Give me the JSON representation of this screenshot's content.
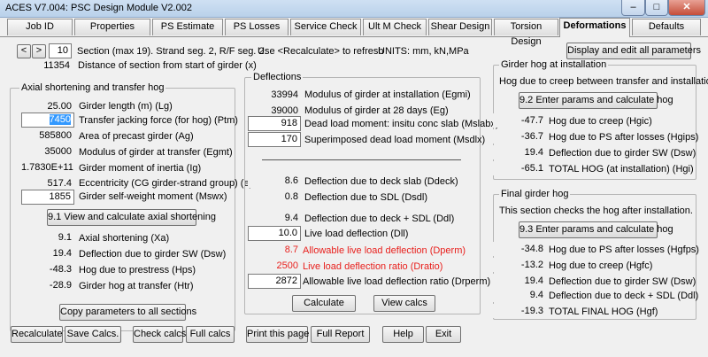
{
  "window": {
    "title": "ACES V7.004:  PSC Design Module V2.002",
    "minimize": "–",
    "maximize": "□",
    "close": "✕"
  },
  "tabs": [
    "Job ID",
    "Properties",
    "PS Estimate",
    "PS Losses",
    "Service Check",
    "Ult M Check",
    "Shear Design",
    "Torsion Design",
    "Deformations",
    "Defaults"
  ],
  "active_tab": "Deformations",
  "header": {
    "prev": "<",
    "next": ">",
    "section_no": "10",
    "section_info": "Section (max 19). Strand seg. 2, R/F seg. 2.",
    "refresh_hint": "Use <Recalculate> to refresh",
    "units": "UNITS: mm, kN,MPa",
    "display_all_button": "Display and edit all parameters",
    "distance_value": "11354",
    "distance_label": "Distance of section from start of girder (x)"
  },
  "axial": {
    "title": "Axial shortening and transfer hog",
    "rows": [
      {
        "value": "25.00",
        "label": "Girder length (m) (Lg)"
      },
      {
        "value": "7450",
        "label": "Transfer jacking force (for hog) (Ptm)"
      },
      {
        "value": "585800",
        "label": "Area of precast girder (Ag)"
      },
      {
        "value": "35000",
        "label": "Modulus of girder at transfer (Egmt)"
      },
      {
        "value": "1.7830E+11",
        "label": "Girder moment of inertia (Ig)"
      },
      {
        "value": "517.4",
        "label": "Eccentricity (CG girder-strand group) (e)"
      },
      {
        "value": "1855",
        "label": "Girder self-weight moment (Mswx)"
      }
    ],
    "calc_button": "9.1 View and calculate axial shortening",
    "results": [
      {
        "value": "9.1",
        "label": "Axial shortening (Xa)"
      },
      {
        "value": "19.4",
        "label": "Deflection due to girder SW (Dsw)"
      },
      {
        "value": "-48.3",
        "label": "Hog due to prestress (Hps)"
      },
      {
        "value": "-28.9",
        "label": "Girder hog at transfer (Htr)"
      }
    ],
    "copy_button": "Copy parameters to all sections"
  },
  "deflections": {
    "title": "Deflections",
    "rows": [
      {
        "value": "33994",
        "label": "Modulus of girder at installation (Egmi)"
      },
      {
        "value": "39000",
        "label": "Modulus of girder at 28 days (Eg)"
      },
      {
        "value": "918",
        "label": "Dead load moment: insitu conc slab (Mslabx)"
      },
      {
        "value": "170",
        "label": "Superimposed dead load moment (Msdlx)"
      }
    ],
    "results": [
      {
        "value": "8.6",
        "label": "Deflection due to deck slab (Ddeck)"
      },
      {
        "value": "0.8",
        "label": "Deflection due to SDL (Dsdl)"
      },
      {
        "value": "9.4",
        "label": "Deflection due to deck + SDL (Ddl)"
      },
      {
        "value": "10.0",
        "label": "Live load deflection (Dll)"
      },
      {
        "value": "8.7",
        "label": "Allowable live load deflection (Dperm)"
      },
      {
        "value": "2500",
        "label": "Live load deflection ratio (Dratio)"
      },
      {
        "value": "2872",
        "label": "Allowable live load deflection ratio (Drperm)"
      }
    ],
    "calculate_button": "Calculate",
    "view_calcs_button": "View calcs"
  },
  "hog_install": {
    "title": "Girder hog at installation",
    "desc": "Hog due to creep between transfer and installation",
    "button": "9.2 Enter params and calculate hog",
    "rows": [
      {
        "value": "-47.7",
        "label": "Hog due to creep (Hgic)"
      },
      {
        "value": "-36.7",
        "label": "Hog due to PS after losses (Hgips)"
      },
      {
        "value": "19.4",
        "label": "Deflection due to girder SW (Dsw)"
      },
      {
        "value": "-65.1",
        "label": "TOTAL HOG (at installation) (Hgi)"
      }
    ]
  },
  "final_hog": {
    "title": "Final girder hog",
    "desc": "This section checks the hog after installation.",
    "button": "9.3 Enter params and calculate hog",
    "rows": [
      {
        "value": "-34.8",
        "label": "Hog due to PS after losses (Hgfps)"
      },
      {
        "value": "-13.2",
        "label": "Hog due to creep (Hgfc)"
      },
      {
        "value": "19.4",
        "label": "Deflection due to girder SW (Dsw)"
      },
      {
        "value": "9.4",
        "label": "Deflection due to deck + SDL (Ddl)"
      },
      {
        "value": "-19.3",
        "label": "TOTAL FINAL HOG (Hgf)"
      }
    ]
  },
  "footer": [
    "Recalculate",
    "Save Calcs.",
    "Check calcs",
    "Full calcs",
    "Print this page",
    "Full Report",
    "Help",
    "Exit"
  ]
}
